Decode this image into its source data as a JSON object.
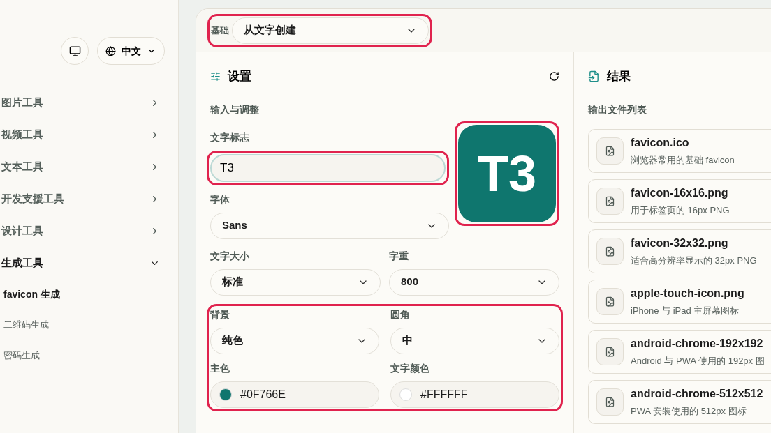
{
  "sidebar": {
    "language": {
      "label": "中文"
    },
    "nav": [
      {
        "label": "图片工具",
        "expanded": false
      },
      {
        "label": "视频工具",
        "expanded": false
      },
      {
        "label": "文本工具",
        "expanded": false
      },
      {
        "label": "开发支援工具",
        "expanded": false
      },
      {
        "label": "设计工具",
        "expanded": false
      },
      {
        "label": "生成工具",
        "expanded": true,
        "children": [
          {
            "label": "favicon 生成",
            "selected": true
          },
          {
            "label": "二维码生成",
            "selected": false
          },
          {
            "label": "密码生成",
            "selected": false
          }
        ]
      }
    ]
  },
  "top_bar": {
    "label": "基础",
    "select": {
      "value": "从文字创建",
      "highlighted": true
    }
  },
  "settings": {
    "title": "设置",
    "section": "输入与调整",
    "text_mark": {
      "label": "文字标志",
      "value": "T3",
      "highlighted": true
    },
    "preview": {
      "text": "T3",
      "highlighted": true
    },
    "font": {
      "label": "字体",
      "value": "Sans"
    },
    "size": {
      "label": "文字大小",
      "value": "标准"
    },
    "weight": {
      "label": "字重",
      "value": "800"
    },
    "group": {
      "highlighted": true,
      "background": {
        "label": "背景",
        "value": "纯色"
      },
      "radius": {
        "label": "圆角",
        "value": "中"
      },
      "primary_color": {
        "label": "主色",
        "value": "#0F766E",
        "color": "#0f766e"
      },
      "text_color": {
        "label": "文字颜色",
        "value": "#FFFFFF",
        "color": "#ffffff"
      }
    }
  },
  "results": {
    "title": "结果",
    "subtitle": "输出文件列表",
    "files": [
      {
        "name": "favicon.ico",
        "description": "浏览器常用的基础 favicon"
      },
      {
        "name": "favicon-16x16.png",
        "description": "用于标签页的 16px PNG"
      },
      {
        "name": "favicon-32x32.png",
        "description": "适合高分辨率显示的 32px PNG"
      },
      {
        "name": "apple-touch-icon.png",
        "description": "iPhone 与 iPad 主屏幕图标"
      },
      {
        "name": "android-chrome-192x192",
        "description": "Android 与 PWA 使用的 192px 图"
      },
      {
        "name": "android-chrome-512x512",
        "description": "PWA 安装使用的 512px 图标"
      }
    ]
  }
}
